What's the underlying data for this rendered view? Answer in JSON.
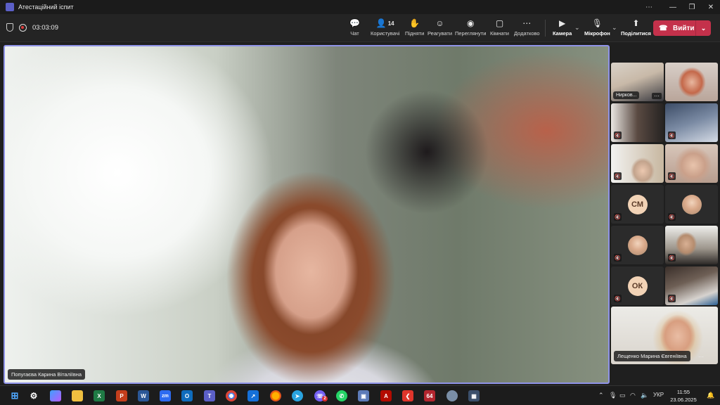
{
  "window": {
    "title": "Атестаційний іспит",
    "minimize": "—",
    "restore": "❐",
    "close": "✕",
    "more": "⋯"
  },
  "meeting": {
    "timer": "03:03:09"
  },
  "toolbar": {
    "chat": "Чат",
    "people": "Користувачі",
    "people_count": "14",
    "raise": "Підняти",
    "react": "Реагувати",
    "view": "Переглянути",
    "rooms": "Кімнати",
    "more": "Додатково",
    "camera": "Камера",
    "mic": "Мікрофон",
    "share": "Поділитися",
    "leave": "Вийти"
  },
  "stage": {
    "speaker_name": "Попугаєва Карина Віталіївна"
  },
  "gallery": {
    "tile1_name": "Нирков...",
    "tile_cm_initials": "СМ",
    "tile_ok_initials": "ОК",
    "featured_name": "Лещенко Марина Євгеніївна"
  },
  "taskbar": {
    "zoom_label": "zm",
    "badge_64": "64",
    "language": "УКР",
    "time": "11:55",
    "date": "23.06.2025",
    "notification_count": "2"
  }
}
